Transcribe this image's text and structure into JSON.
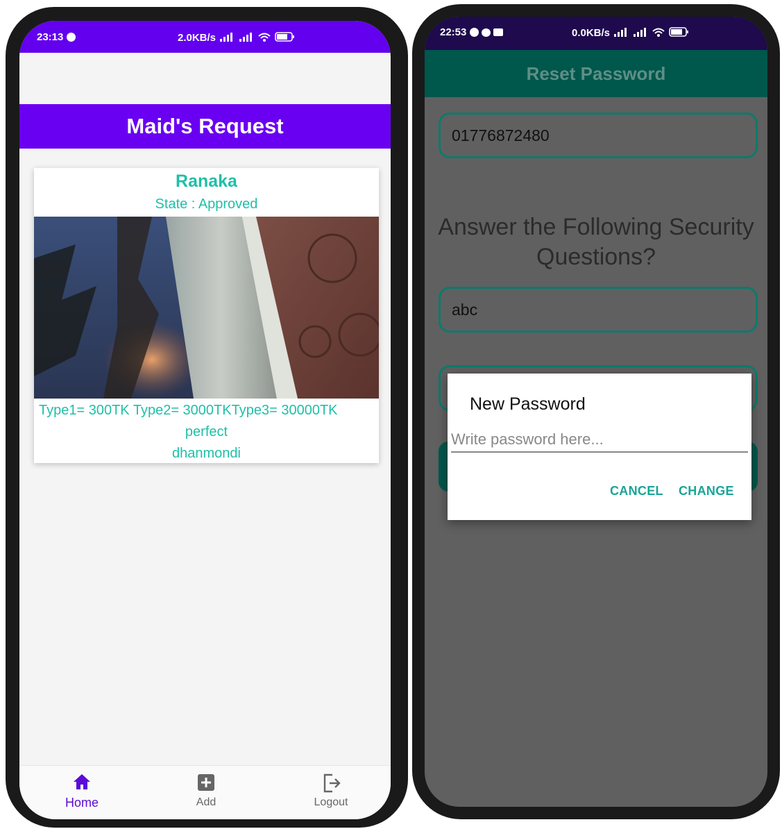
{
  "left": {
    "status": {
      "time": "23:13",
      "network": "2.0KB/s",
      "battery": "64"
    },
    "title": "Maid's Request",
    "card": {
      "name": "Ranaka",
      "state": "State : Approved",
      "types": "Type1= 300TK  Type2= 3000TKType3= 30000TK",
      "note": "perfect",
      "location": "dhanmondi"
    },
    "nav": [
      {
        "label": "Home",
        "icon": "home-icon"
      },
      {
        "label": "Add",
        "icon": "add-icon"
      },
      {
        "label": "Logout",
        "icon": "logout-icon"
      }
    ],
    "colors": {
      "primary": "#6a00f2",
      "accent": "#1fbfa8"
    }
  },
  "right": {
    "status": {
      "time": "22:53",
      "network": "0.0KB/s",
      "battery": "66"
    },
    "title": "Reset Password",
    "phone_value": "01776872480",
    "question": "Answer the Following Security Questions?",
    "answer_value": "abc",
    "dialog": {
      "title": "New Password",
      "placeholder": "Write password here...",
      "cancel": "CANCEL",
      "change": "CHANGE"
    },
    "colors": {
      "primary": "#00574c",
      "accent": "#1aa597"
    }
  }
}
